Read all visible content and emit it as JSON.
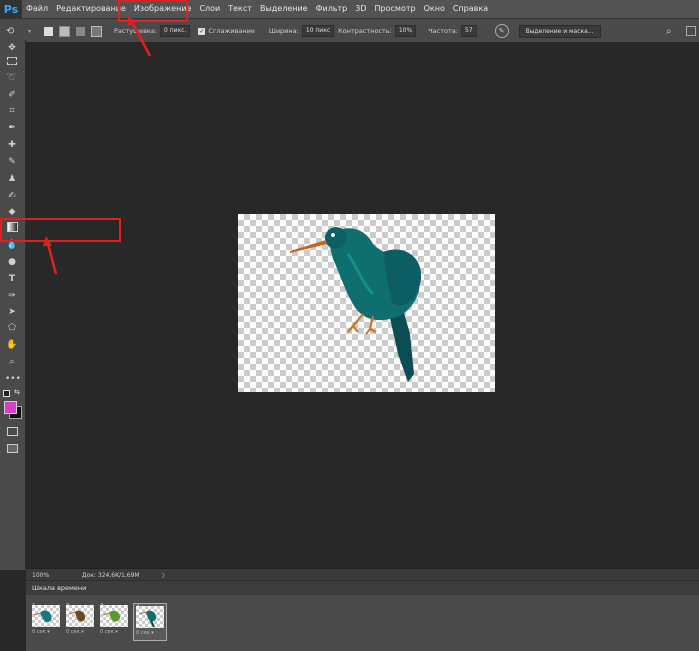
{
  "app_logo": "Ps",
  "menu": [
    "Файл",
    "Редактирование",
    "Изображение",
    "Слои",
    "Текст",
    "Выделение",
    "Фильтр",
    "3D",
    "Просмотр",
    "Окно",
    "Справка"
  ],
  "options": {
    "feather_label": "Растушевка:",
    "feather_value": "0 пикс.",
    "antialias_label": "Сглаживание",
    "width_label": "Ширина:",
    "width_value": "10 пикс",
    "contrast_label": "Контрастность:",
    "contrast_value": "10%",
    "frequency_label": "Частота:",
    "frequency_value": "57",
    "select_mask_label": "Выделение и маска..."
  },
  "status": {
    "zoom": "100%",
    "doc_info": "Док: 324,6K/1,69M",
    "arrow": "〉"
  },
  "timeline": {
    "title": "Шкала времени",
    "frames": [
      {
        "num": "1",
        "delay": "0 сек.▾",
        "selected": false
      },
      {
        "num": "2",
        "delay": "0 сек.▾",
        "selected": false
      },
      {
        "num": "3",
        "delay": "0 сек.▾",
        "selected": false
      },
      {
        "num": "4",
        "delay": "0 сек.▾",
        "selected": true
      }
    ]
  },
  "colors": {
    "foreground": "#d640c8",
    "background": "#111111",
    "annotation": "#e02020",
    "bird_body": "#0f6e6e",
    "bird_beak": "#c8641e"
  }
}
